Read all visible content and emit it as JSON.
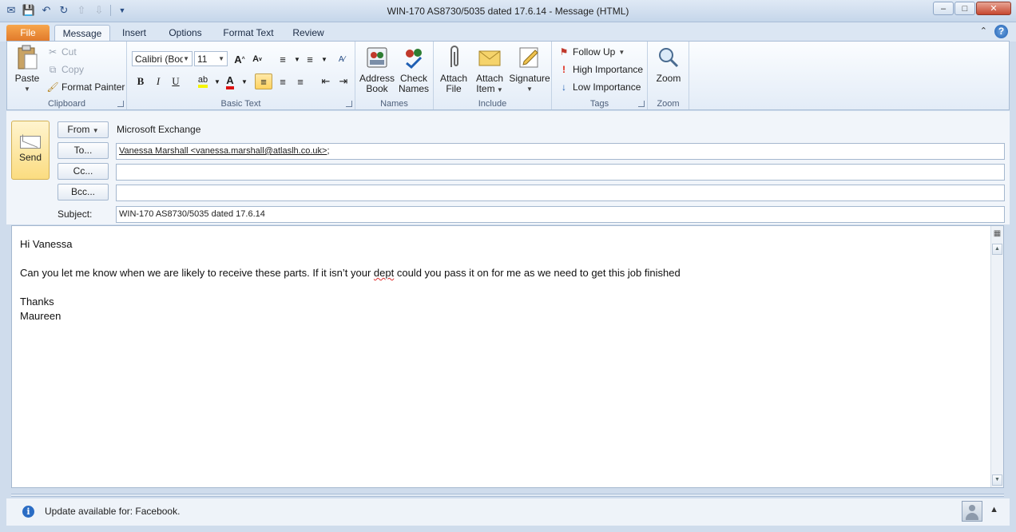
{
  "window": {
    "title": "WIN-170  AS8730/5035 dated 17.6.14  -  Message (HTML)",
    "minimize": "–",
    "maximize": "□",
    "close": "✕"
  },
  "tabs": [
    {
      "label": "File"
    },
    {
      "label": "Message"
    },
    {
      "label": "Insert"
    },
    {
      "label": "Options"
    },
    {
      "label": "Format Text"
    },
    {
      "label": "Review"
    }
  ],
  "ribbon": {
    "clipboard": {
      "label": "Clipboard",
      "paste": "Paste",
      "cut": "Cut",
      "copy": "Copy",
      "format_painter": "Format Painter"
    },
    "basic_text": {
      "label": "Basic Text",
      "font": "Calibri (Body)",
      "size": "11",
      "bold": "B",
      "italic": "I",
      "underline": "U"
    },
    "names": {
      "label": "Names",
      "address_book_1": "Address",
      "address_book_2": "Book",
      "check_names_1": "Check",
      "check_names_2": "Names"
    },
    "include": {
      "label": "Include",
      "attach_file_1": "Attach",
      "attach_file_2": "File",
      "attach_item_1": "Attach",
      "attach_item_2": "Item",
      "signature": "Signature"
    },
    "tags": {
      "label": "Tags",
      "follow_up": "Follow Up",
      "high_importance": "High Importance",
      "low_importance": "Low Importance"
    },
    "zoom": {
      "label": "Zoom",
      "zoom": "Zoom"
    }
  },
  "header": {
    "send": "Send",
    "from_button": "From",
    "from_value": "Microsoft Exchange",
    "to_button": "To...",
    "to_value": "Vanessa Marshall <vanessa.marshall@atlaslh.co.uk>",
    "to_suffix": ";",
    "cc_button": "Cc...",
    "cc_value": "",
    "bcc_button": "Bcc...",
    "bcc_value": "",
    "subject_label": "Subject:",
    "subject_value": "WIN-170  AS8730/5035 dated 17.6.14"
  },
  "body": {
    "greeting": "Hi Vanessa",
    "line_pre": "Can you let me know when we are likely to receive these parts. If it isn’t your ",
    "line_misspelled": "dept",
    "line_post": " could you pass it on for me as we need to get this job finished",
    "thanks": "Thanks",
    "signature": "Maureen"
  },
  "infobar": {
    "text": "Update available for: Facebook."
  },
  "colors": {
    "file_tab": "#e0782a",
    "send_button": "#fbdc80",
    "accent": "#2a6cc4"
  }
}
